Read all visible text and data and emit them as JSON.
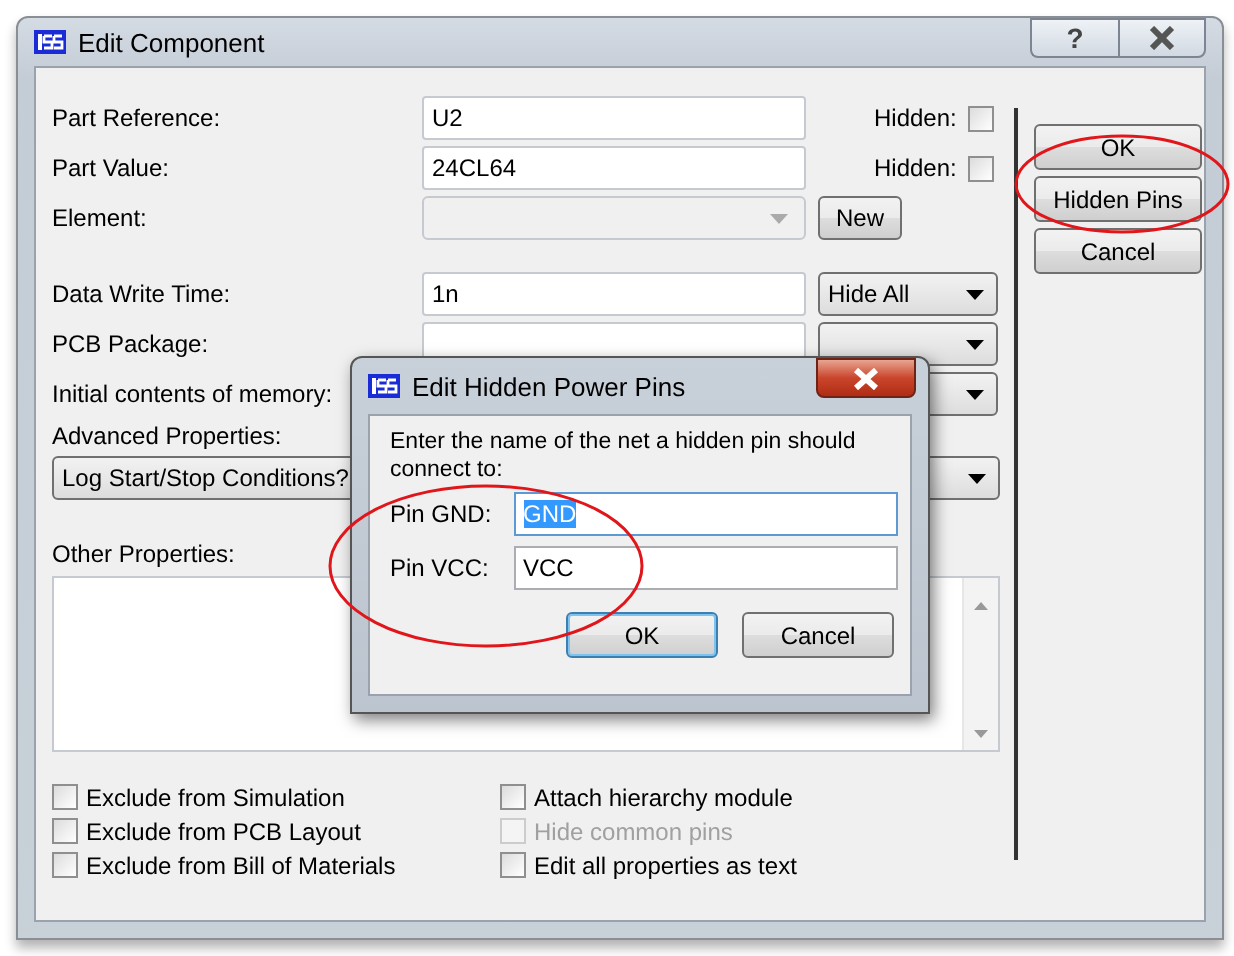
{
  "window": {
    "title": "Edit Component",
    "help_button": "?"
  },
  "rows": [
    {
      "kind": "text",
      "label": "Part Reference:",
      "value": "U2",
      "hidden_label": "Hidden:",
      "hidden": false
    },
    {
      "kind": "text",
      "label": "Part Value:",
      "value": "24CL64",
      "hidden_label": "Hidden:",
      "hidden": false
    },
    {
      "kind": "combo",
      "label": "Element:",
      "disabled": true,
      "button": "New"
    },
    {
      "kind": "visibility",
      "label": "Data Write Time:",
      "value": "1n",
      "visibility": "Hide All"
    },
    {
      "kind": "covered",
      "label": "PCB Package:"
    },
    {
      "kind": "covered",
      "label": "Initial contents of memory:"
    }
  ],
  "advanced": {
    "label": "Advanced Properties:",
    "value": "Log Start/Stop Conditions?"
  },
  "other_properties": {
    "label": "Other Properties:"
  },
  "checkboxes_left": [
    {
      "label": "Exclude from Simulation",
      "checked": false,
      "disabled": false
    },
    {
      "label": "Exclude from PCB Layout",
      "checked": false,
      "disabled": false
    },
    {
      "label": "Exclude from Bill of Materials",
      "checked": false,
      "disabled": false
    }
  ],
  "checkboxes_right": [
    {
      "label": "Attach hierarchy module",
      "checked": false,
      "disabled": false
    },
    {
      "label": "Hide common pins",
      "checked": false,
      "disabled": true
    },
    {
      "label": "Edit all properties as text",
      "checked": false,
      "disabled": false
    }
  ],
  "buttons": [
    {
      "label": "OK",
      "highlighted": false
    },
    {
      "label": "Hidden Pins",
      "highlighted": true
    },
    {
      "label": "Cancel",
      "highlighted": false
    }
  ],
  "dialog": {
    "title": "Edit Hidden Power Pins",
    "message": "Enter the name of the net a hidden pin should connect to:",
    "fields": [
      {
        "label": "Pin GND:",
        "value": "GND",
        "selected": true
      },
      {
        "label": "Pin VCC:",
        "value": "VCC",
        "selected": false
      }
    ],
    "buttons": [
      {
        "label": "OK",
        "default": true
      },
      {
        "label": "Cancel",
        "default": false
      }
    ],
    "highlighted": true
  }
}
